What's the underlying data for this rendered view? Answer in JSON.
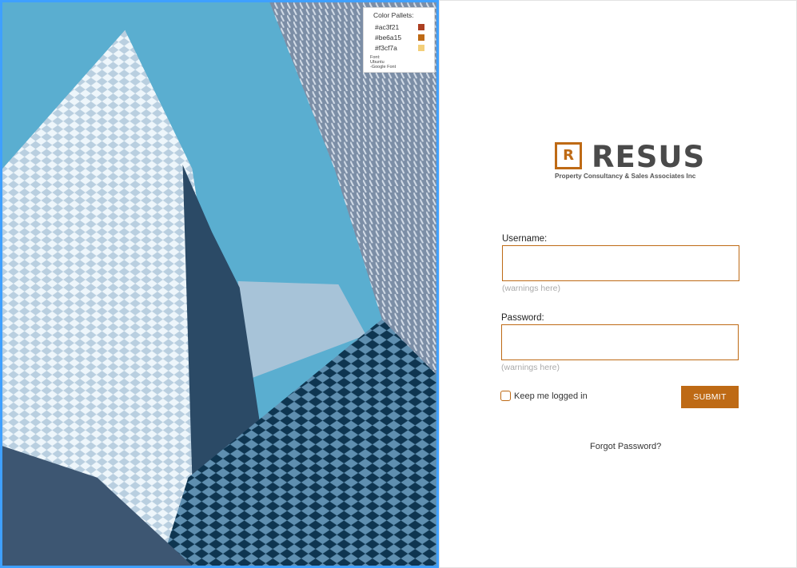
{
  "palette": {
    "title": "Color Pallets:",
    "colors": [
      {
        "label": "#ac3f21",
        "hex": "#ac3f21"
      },
      {
        "label": "#be6a15",
        "hex": "#be6a15"
      },
      {
        "label": "#f3cf7a",
        "hex": "#f3cf7a"
      }
    ],
    "font_line1": "Font:",
    "font_line2": "Ubuntu",
    "font_line3": "-Google Font"
  },
  "brand": {
    "mark": "R",
    "name": "RESUS",
    "tagline": "Property Consultancy & Sales Associates Inc"
  },
  "form": {
    "username_label": "Username:",
    "username_value": "",
    "username_warning": "(warnings here)",
    "password_label": "Password:",
    "password_value": "",
    "password_warning": "(warnings here)",
    "keep_logged_in": "Keep me logged in",
    "submit_label": "SUBMIT",
    "forgot_label": "Forgot Password?"
  },
  "colors": {
    "accent": "#be6a15",
    "selection_border": "#3fa0ff"
  }
}
